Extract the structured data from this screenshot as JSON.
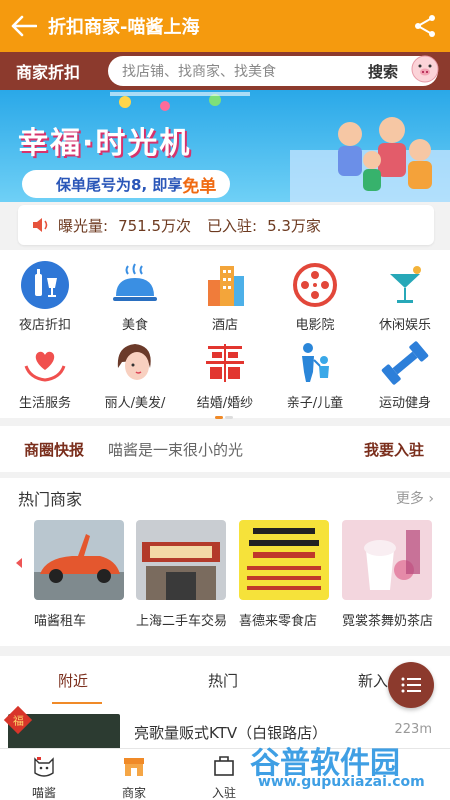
{
  "header": {
    "title": "折扣商家-喵酱上海"
  },
  "search": {
    "section_label": "商家折扣",
    "placeholder": "找店铺、找商家、找美食",
    "button": "搜索"
  },
  "banner": {
    "title": "幸福·时光机",
    "subtitle_prefix": "保单尾号为8, 即享",
    "subtitle_highlight": "免单"
  },
  "stats": {
    "exposure_label": "曝光量:",
    "exposure_value": "751.5万次",
    "joined_label": "已入驻:",
    "joined_value": "5.3万家"
  },
  "categories": [
    {
      "label": "夜店折扣",
      "icon": "bottles-icon"
    },
    {
      "label": "美食",
      "icon": "food-cloche-icon"
    },
    {
      "label": "酒店",
      "icon": "hotel-icon"
    },
    {
      "label": "电影院",
      "icon": "film-reel-icon"
    },
    {
      "label": "休闲娱乐",
      "icon": "cocktail-icon"
    },
    {
      "label": "生活服务",
      "icon": "heart-hands-icon"
    },
    {
      "label": "丽人/美发/",
      "icon": "beauty-face-icon"
    },
    {
      "label": "结婚/婚纱",
      "icon": "double-happiness-icon"
    },
    {
      "label": "亲子/儿童",
      "icon": "parent-child-icon"
    },
    {
      "label": "运动健身",
      "icon": "dumbbell-icon"
    }
  ],
  "news": {
    "label": "商圈快报",
    "message": "喵酱是一束很小的光",
    "action": "我要入驻"
  },
  "hot": {
    "title": "热门商家",
    "more": "更多",
    "items": [
      {
        "caption": "喵酱租车",
        "color": "#e4572e"
      },
      {
        "caption": "上海二手车交易",
        "color": "#b33a2a"
      },
      {
        "caption": "喜德来零食店",
        "color": "#f6e23a"
      },
      {
        "caption": "霓裳茶舞奶茶店",
        "color": "#f0c8d6"
      }
    ]
  },
  "tabs": {
    "items": [
      "附近",
      "热门",
      "新入"
    ],
    "active": "附近"
  },
  "list": {
    "badge": "福",
    "name": "亮歌量贩式KTV（白银路店）",
    "distance": "223m"
  },
  "bottom_nav": {
    "items": [
      "喵酱",
      "商家",
      "入驻"
    ]
  },
  "watermark": {
    "text": "谷普软件园",
    "url": "www.gupuxiazai.com"
  },
  "colors": {
    "primary": "#f59a0e",
    "brand_dark": "#8c3a2d",
    "accent": "#f08a28"
  }
}
